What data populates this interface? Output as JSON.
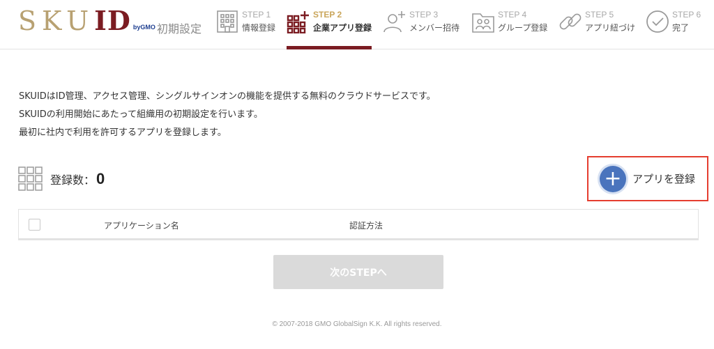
{
  "header": {
    "logo": {
      "main": "SKU",
      "accent": "ID",
      "by": "byGMO"
    },
    "setup_label": "初期設定",
    "steps": [
      {
        "num": "STEP 1",
        "name": "情報登録",
        "icon": "building-icon",
        "active": false
      },
      {
        "num": "STEP 2",
        "name": "企業アプリ登録",
        "icon": "app-grid-plus-icon",
        "active": true
      },
      {
        "num": "STEP 3",
        "name": "メンバー招待",
        "icon": "user-plus-icon",
        "active": false
      },
      {
        "num": "STEP 4",
        "name": "グループ登録",
        "icon": "group-folder-icon",
        "active": false
      },
      {
        "num": "STEP 5",
        "name": "アプリ紐づけ",
        "icon": "link-icon",
        "active": false
      },
      {
        "num": "STEP 6",
        "name": "完了",
        "icon": "check-circle-icon",
        "active": false
      }
    ]
  },
  "description": [
    "SKUIDはID管理、アクセス管理、シングルサインオンの機能を提供する無料のクラウドサービスです。",
    "SKUIDの利用開始にあたって組織用の初期設定を行います。",
    "最初に社内で利用を許可するアプリを登録します。"
  ],
  "count": {
    "label": "登録数：",
    "value": "0",
    "icon": "app-grid-icon"
  },
  "register_button": {
    "label": "アプリを登録",
    "icon": "plus-icon",
    "accent_color": "#4a74bd",
    "highlight_color": "#e53d2f"
  },
  "table": {
    "columns": [
      "アプリケーション名",
      "認証方法"
    ]
  },
  "next_button": {
    "label": "次のSTEPへ"
  },
  "footer": "© 2007-2018 GMO GlobalSign K.K. All rights reserved.",
  "colors": {
    "brand_gold": "#b8a172",
    "brand_red": "#7b1c22",
    "step_active": "#c9a55a"
  }
}
